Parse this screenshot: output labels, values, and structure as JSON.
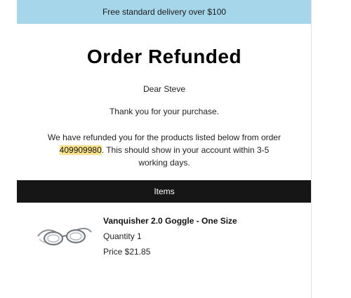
{
  "banner": {
    "text": "Free standard delivery over $100"
  },
  "heading": {
    "title": "Order Refunded"
  },
  "body": {
    "greeting": "Dear Steve",
    "thanks": "Thank you for your purchase.",
    "message_before": "We have refunded you for the products listed below from order ",
    "order_number": "409909980",
    "message_after": ". This should show in your account within 3-5 working days."
  },
  "items": {
    "header": "Items",
    "list": [
      {
        "name": "Vanquisher 2.0 Goggle - One Size",
        "quantity": "Quantity 1",
        "price": "Price $21.85",
        "image_icon": "swim-goggles-icon"
      }
    ]
  },
  "colors": {
    "banner_bg": "#a6d6ea",
    "items_header_bg": "#161616",
    "order_highlight": "#fbe38b"
  }
}
